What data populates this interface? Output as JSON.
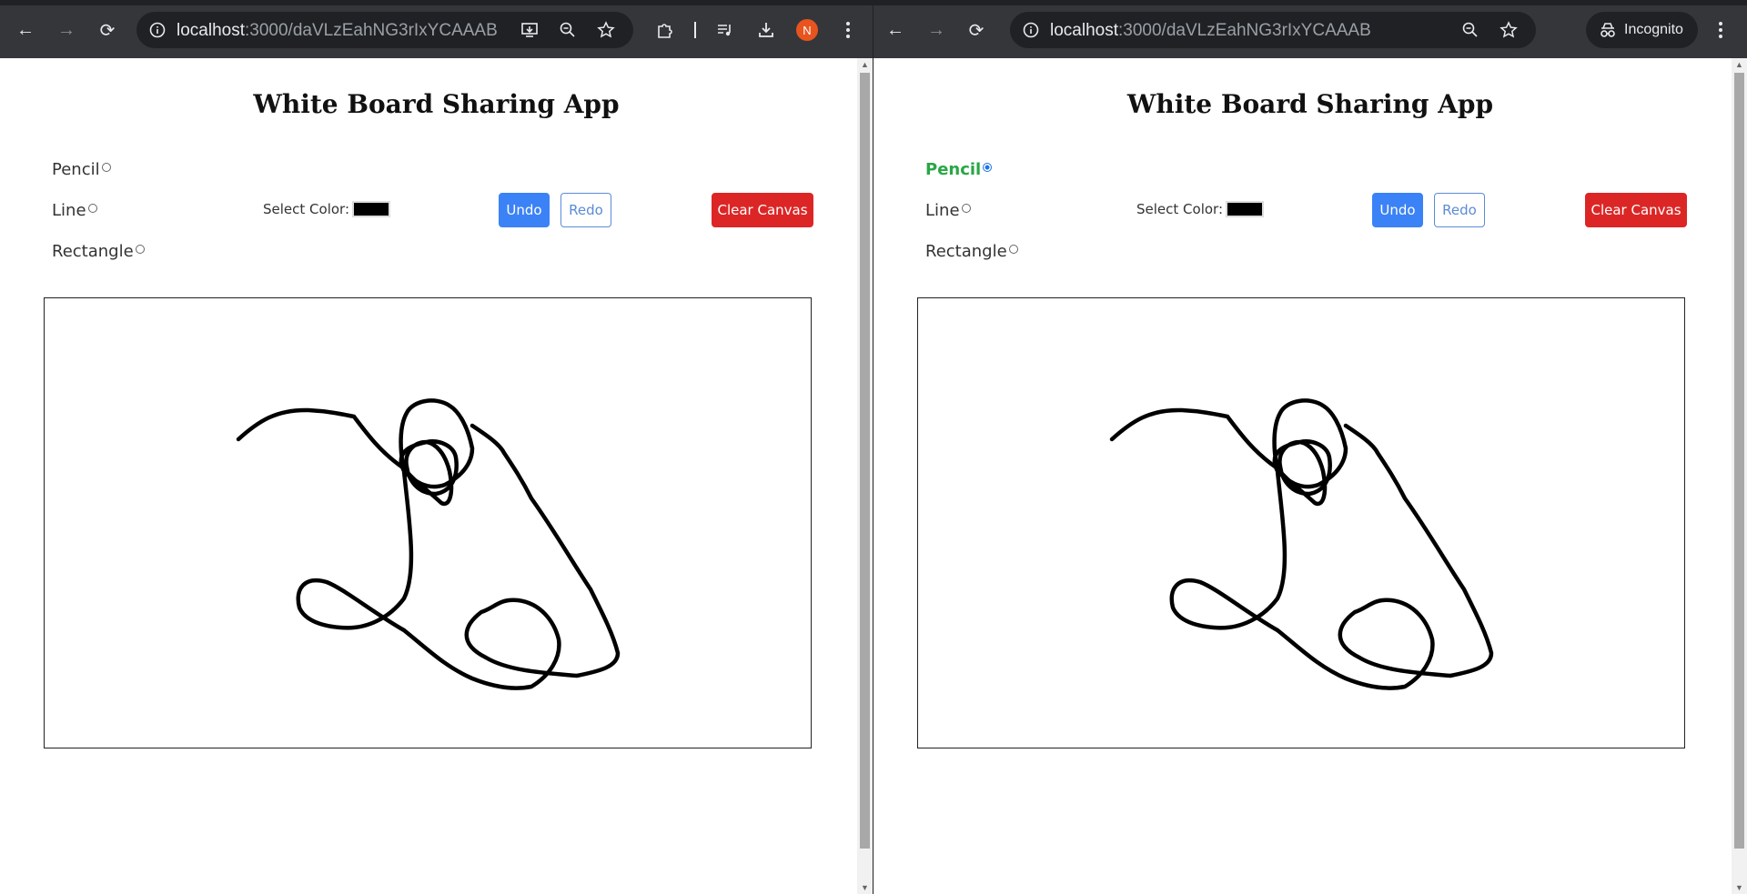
{
  "browser": {
    "url_host": "localhost",
    "url_path": ":3000/daVLzEahNG3rIxYCAAAB",
    "profile_initial": "N",
    "incognito_label": "Incognito"
  },
  "app": {
    "title": "White Board Sharing App",
    "tools": {
      "pencil": "Pencil",
      "line": "Line",
      "rectangle": "Rectangle"
    },
    "color_label": "Select Color:",
    "color_value": "#000000",
    "undo": "Undo",
    "redo": "Redo",
    "clear": "Clear Canvas"
  },
  "colors": {
    "undo": "#3b82f6",
    "redo": "#5b8bd8",
    "clear": "#dc2626",
    "active_tool": "#28a745"
  }
}
